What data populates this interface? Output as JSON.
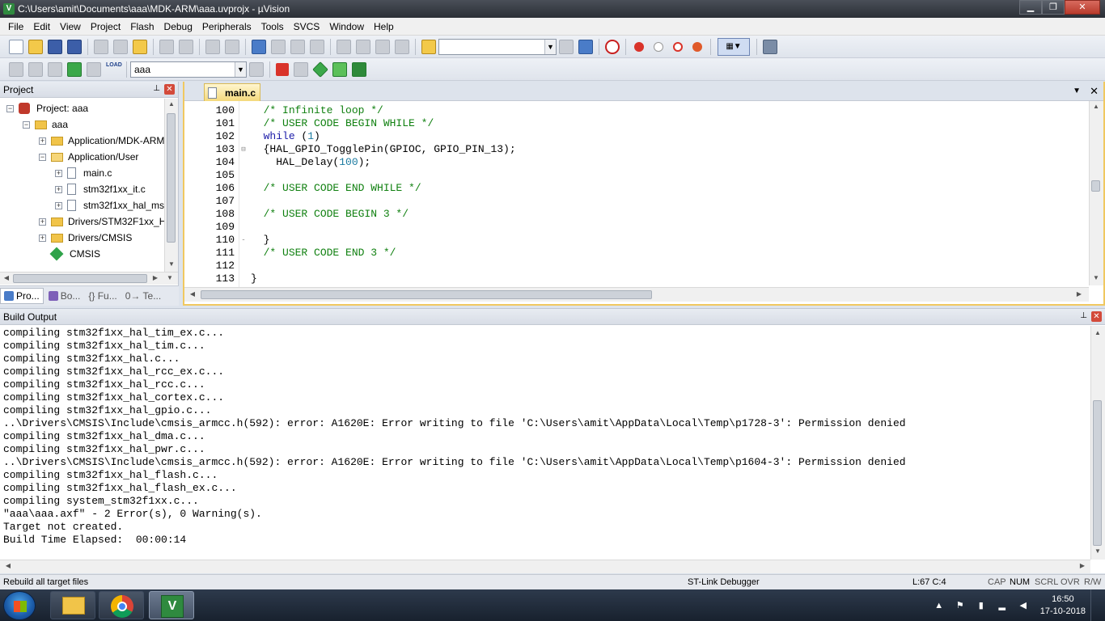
{
  "window": {
    "title": "C:\\Users\\amit\\Documents\\aaa\\MDK-ARM\\aaa.uvprojx - µVision",
    "app_icon": "V",
    "minimize": "▁",
    "maximize": "❐",
    "close": "✕"
  },
  "menu": [
    "File",
    "Edit",
    "View",
    "Project",
    "Flash",
    "Debug",
    "Peripherals",
    "Tools",
    "SVCS",
    "Window",
    "Help"
  ],
  "toolbar": {
    "find_combo_value": "",
    "target_combo_value": "aaa",
    "load_label": "LOAD"
  },
  "project_pane": {
    "title": "Project",
    "pin": "⊥",
    "close": "✕",
    "tree": [
      {
        "label": "Project: aaa",
        "expander": "−",
        "icon": "project"
      },
      {
        "label": "aaa",
        "expander": "−",
        "icon": "folder"
      },
      {
        "label": "Application/MDK-ARM",
        "expander": "+",
        "icon": "folder"
      },
      {
        "label": "Application/User",
        "expander": "−",
        "icon": "folder"
      },
      {
        "label": "main.c",
        "expander": "+",
        "icon": "file"
      },
      {
        "label": "stm32f1xx_it.c",
        "expander": "+",
        "icon": "file"
      },
      {
        "label": "stm32f1xx_hal_msp.c",
        "expander": "+",
        "icon": "file"
      },
      {
        "label": "Drivers/STM32F1xx_HAL_Driver",
        "expander": "+",
        "icon": "folder"
      },
      {
        "label": "Drivers/CMSIS",
        "expander": "+",
        "icon": "folder"
      },
      {
        "label": "CMSIS",
        "expander": "",
        "icon": "cmsis"
      }
    ],
    "tabs": [
      "Pro...",
      "Bo...",
      "{} Fu...",
      "0→ Te..."
    ]
  },
  "editor": {
    "active_tab": "main.c",
    "tab_menu": "▼",
    "tab_close": "✕",
    "lines": [
      {
        "no": "100",
        "fold": "",
        "segments": [
          {
            "t": "  ",
            "c": ""
          },
          {
            "t": "/* Infinite loop */",
            "c": "cm"
          }
        ]
      },
      {
        "no": "101",
        "fold": "",
        "segments": [
          {
            "t": "  ",
            "c": ""
          },
          {
            "t": "/* USER CODE BEGIN WHILE */",
            "c": "cm"
          }
        ]
      },
      {
        "no": "102",
        "fold": "",
        "segments": [
          {
            "t": "  ",
            "c": ""
          },
          {
            "t": "while",
            "c": "kw"
          },
          {
            "t": " (",
            "c": ""
          },
          {
            "t": "1",
            "c": "num"
          },
          {
            "t": ")",
            "c": ""
          }
        ]
      },
      {
        "no": "103",
        "fold": "⊟",
        "segments": [
          {
            "t": "  {HAL_GPIO_TogglePin(GPIOC, GPIO_PIN_13);",
            "c": ""
          }
        ]
      },
      {
        "no": "104",
        "fold": "",
        "segments": [
          {
            "t": "    HAL_Delay(",
            "c": ""
          },
          {
            "t": "100",
            "c": "num"
          },
          {
            "t": ");",
            "c": ""
          }
        ]
      },
      {
        "no": "105",
        "fold": "",
        "segments": [
          {
            "t": "",
            "c": ""
          }
        ]
      },
      {
        "no": "106",
        "fold": "",
        "segments": [
          {
            "t": "  ",
            "c": ""
          },
          {
            "t": "/* USER CODE END WHILE */",
            "c": "cm"
          }
        ]
      },
      {
        "no": "107",
        "fold": "",
        "segments": [
          {
            "t": "",
            "c": ""
          }
        ]
      },
      {
        "no": "108",
        "fold": "",
        "segments": [
          {
            "t": "  ",
            "c": ""
          },
          {
            "t": "/* USER CODE BEGIN 3 */",
            "c": "cm"
          }
        ]
      },
      {
        "no": "109",
        "fold": "",
        "segments": [
          {
            "t": "",
            "c": ""
          }
        ]
      },
      {
        "no": "110",
        "fold": "-",
        "segments": [
          {
            "t": "  }",
            "c": ""
          }
        ]
      },
      {
        "no": "111",
        "fold": "",
        "segments": [
          {
            "t": "  ",
            "c": ""
          },
          {
            "t": "/* USER CODE END 3 */",
            "c": "cm"
          }
        ]
      },
      {
        "no": "112",
        "fold": "",
        "segments": [
          {
            "t": "",
            "c": ""
          }
        ]
      },
      {
        "no": "113",
        "fold": "",
        "segments": [
          {
            "t": "}",
            "c": ""
          }
        ]
      }
    ]
  },
  "build_output": {
    "title": "Build Output",
    "pin": "⊥",
    "close": "✕",
    "lines": [
      "compiling stm32f1xx_hal_tim_ex.c...",
      "compiling stm32f1xx_hal_tim.c...",
      "compiling stm32f1xx_hal.c...",
      "compiling stm32f1xx_hal_rcc_ex.c...",
      "compiling stm32f1xx_hal_rcc.c...",
      "compiling stm32f1xx_hal_cortex.c...",
      "compiling stm32f1xx_hal_gpio.c...",
      "..\\Drivers\\CMSIS\\Include\\cmsis_armcc.h(592): error: A1620E: Error writing to file 'C:\\Users\\amit\\AppData\\Local\\Temp\\p1728-3': Permission denied",
      "compiling stm32f1xx_hal_dma.c...",
      "compiling stm32f1xx_hal_pwr.c...",
      "..\\Drivers\\CMSIS\\Include\\cmsis_armcc.h(592): error: A1620E: Error writing to file 'C:\\Users\\amit\\AppData\\Local\\Temp\\p1604-3': Permission denied",
      "compiling stm32f1xx_hal_flash.c...",
      "compiling stm32f1xx_hal_flash_ex.c...",
      "compiling system_stm32f1xx.c...",
      "\"aaa\\aaa.axf\" - 2 Error(s), 0 Warning(s).",
      "Target not created.",
      "Build Time Elapsed:  00:00:14"
    ]
  },
  "status_bar": {
    "message": "Rebuild all target files",
    "debugger": "ST-Link Debugger",
    "position": "L:67 C:4",
    "cap": "CAP",
    "num": "NUM",
    "scrl": "SCRL",
    "ovr": "OVR",
    "rw": "R/W"
  },
  "taskbar": {
    "uvision_label": "V",
    "time": "16:50",
    "date": "17-10-2018"
  }
}
